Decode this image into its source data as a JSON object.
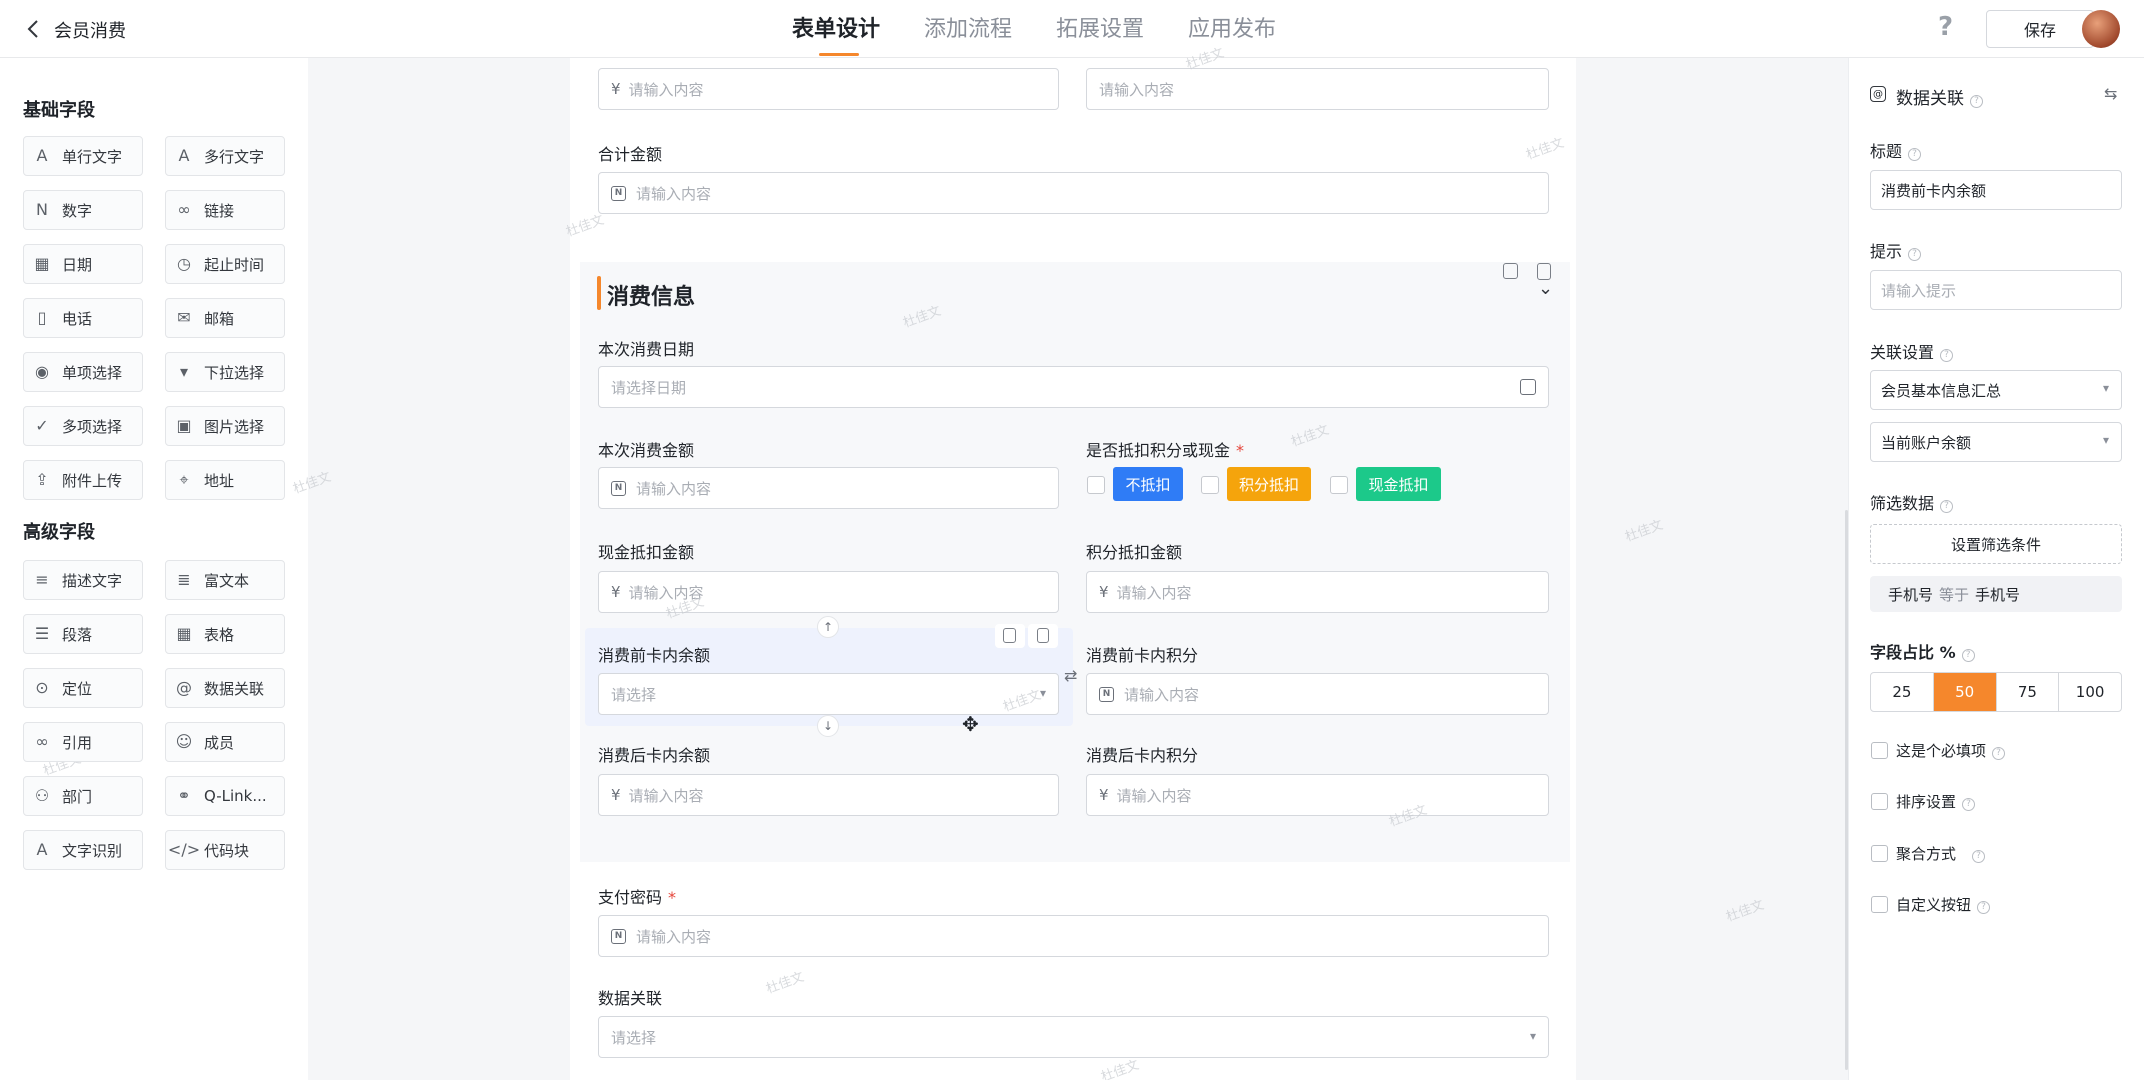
{
  "header": {
    "title": "会员消费",
    "tabs": [
      "表单设计",
      "添加流程",
      "拓展设置",
      "应用发布"
    ],
    "help": "?",
    "save_label": "保存"
  },
  "palette": {
    "basic_title": "基础字段",
    "basic": [
      {
        "label": "单行文字",
        "icon": "text-line-icon"
      },
      {
        "label": "多行文字",
        "icon": "text-multiline-icon"
      },
      {
        "label": "数字",
        "icon": "number-icon"
      },
      {
        "label": "链接",
        "icon": "link-icon"
      },
      {
        "label": "日期",
        "icon": "calendar-icon"
      },
      {
        "label": "起止时间",
        "icon": "clock-icon"
      },
      {
        "label": "电话",
        "icon": "phone-icon"
      },
      {
        "label": "邮箱",
        "icon": "mail-icon"
      },
      {
        "label": "单项选择",
        "icon": "radio-icon"
      },
      {
        "label": "下拉选择",
        "icon": "dropdown-icon"
      },
      {
        "label": "多项选择",
        "icon": "checkbox-icon"
      },
      {
        "label": "图片选择",
        "icon": "image-icon"
      },
      {
        "label": "附件上传",
        "icon": "upload-icon"
      },
      {
        "label": "地址",
        "icon": "location-pin-icon"
      }
    ],
    "advanced_title": "高级字段",
    "advanced": [
      {
        "label": "描述文字",
        "icon": "description-icon"
      },
      {
        "label": "富文本",
        "icon": "rich-text-icon"
      },
      {
        "label": "段落",
        "icon": "paragraph-icon"
      },
      {
        "label": "表格",
        "icon": "table-icon"
      },
      {
        "label": "定位",
        "icon": "locate-icon"
      },
      {
        "label": "数据关联",
        "icon": "data-link-icon"
      },
      {
        "label": "引用",
        "icon": "reference-icon"
      },
      {
        "label": "成员",
        "icon": "member-icon"
      },
      {
        "label": "部门",
        "icon": "department-icon"
      },
      {
        "label": "Q-Link...",
        "icon": "qlink-icon"
      },
      {
        "label": "文字识别",
        "icon": "ocr-icon"
      },
      {
        "label": "代码块",
        "icon": "code-icon"
      }
    ]
  },
  "form": {
    "top_input_left_prefix": "¥",
    "top_input_left_placeholder": "请输入内容",
    "top_input_right_placeholder": "请输入内容",
    "total_label": "合计金额",
    "total_placeholder": "请输入内容",
    "section_title": "消费信息",
    "consume_date_label": "本次消费日期",
    "consume_date_placeholder": "请选择日期",
    "consume_amount_label": "本次消费金额",
    "consume_amount_placeholder": "请输入内容",
    "deduct_label": "是否抵扣积分或现金",
    "required_mark": "*",
    "deduct_options": [
      {
        "label": "不抵扣",
        "color": "#2f7cf6"
      },
      {
        "label": "积分抵扣",
        "color": "#f5a40c"
      },
      {
        "label": "现金抵扣",
        "color": "#1cc98a"
      }
    ],
    "cash_deduct_label": "现金抵扣金额",
    "cash_deduct_placeholder": "请输入内容",
    "points_deduct_label": "积分抵扣金额",
    "points_deduct_placeholder": "请输入内容",
    "balance_before_label": "消费前卡内余额",
    "balance_before_placeholder": "请选择",
    "points_before_label": "消费前卡内积分",
    "points_before_placeholder": "请输入内容",
    "balance_after_label": "消费后卡内余额",
    "balance_after_placeholder": "请输入内容",
    "points_after_label": "消费后卡内积分",
    "points_after_placeholder": "请输入内容",
    "password_label": "支付密码",
    "password_placeholder": "请输入内容",
    "data_link_label": "数据关联",
    "data_link_placeholder": "请选择",
    "currency": "¥",
    "number_badge": "N",
    "watermark": "杜佳文"
  },
  "props": {
    "title": "数据关联",
    "title_label": "标题",
    "title_value": "消费前卡内余额",
    "hint_label": "提示",
    "hint_placeholder": "请输入提示",
    "link_label": "关联设置",
    "link_source": "会员基本信息汇总",
    "link_field": "当前账户余额",
    "filter_label": "筛选数据",
    "filter_button": "设置筛选条件",
    "filter_left": "手机号",
    "filter_op": "等于",
    "filter_right": "手机号",
    "ratio_label": "字段占比 %",
    "ratio_options": [
      "25",
      "50",
      "75",
      "100"
    ],
    "ratio_selected": "50",
    "checks": [
      "这是个必填项",
      "排序设置",
      "聚合方式",
      "自定义按钮"
    ],
    "accent": "#f5872c"
  }
}
